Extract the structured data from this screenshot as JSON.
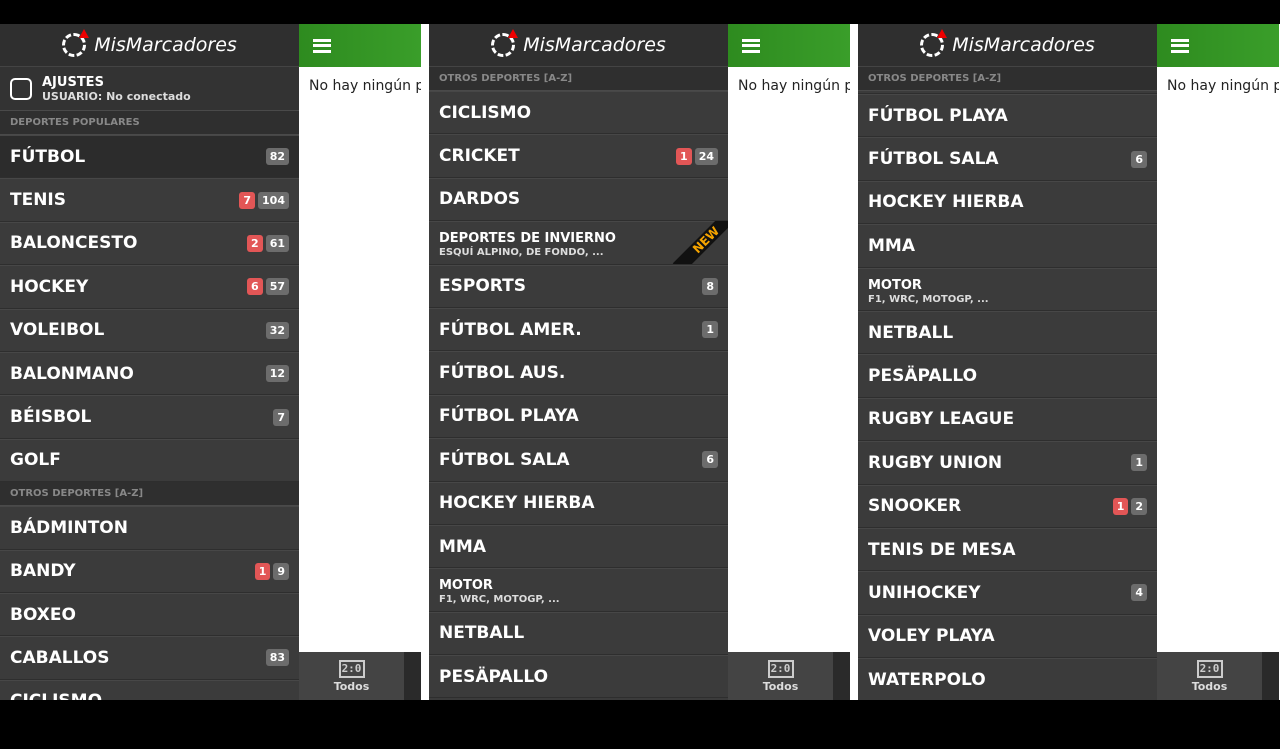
{
  "app": {
    "logo": "MisMarcadores",
    "empty_message": "No hay ningún pa",
    "nav_tab": "Todos",
    "nav_icon_text": "2:0"
  },
  "settings": {
    "title": "AJUSTES",
    "subtitle": "USUARIO: No conectado"
  },
  "colors": {
    "live_badge": "#e25656",
    "count_badge": "#6c6c6c",
    "header_green": "#3a9e2a",
    "new_ribbon": "#f5a400"
  },
  "panels": [
    {
      "settings": true,
      "offset": 0,
      "items": [
        {
          "section": "DEPORTES POPULARES"
        },
        {
          "name": "FÚTBOL",
          "count": "82",
          "active": true
        },
        {
          "name": "TENIS",
          "live": "7",
          "count": "104"
        },
        {
          "name": "BALONCESTO",
          "live": "2",
          "count": "61"
        },
        {
          "name": "HOCKEY",
          "live": "6",
          "count": "57"
        },
        {
          "name": "VOLEIBOL",
          "count": "32"
        },
        {
          "name": "BALONMANO",
          "count": "12"
        },
        {
          "name": "BÉISBOL",
          "count": "7"
        },
        {
          "name": "GOLF"
        },
        {
          "section": "OTROS DEPORTES [A-Z]"
        },
        {
          "name": "BÁDMINTON"
        },
        {
          "name": "BANDY",
          "live": "1",
          "count": "9"
        },
        {
          "name": "BOXEO"
        },
        {
          "name": "CABALLOS",
          "count": "83"
        },
        {
          "name": "CICLISMO"
        }
      ]
    },
    {
      "settings": false,
      "items": [
        {
          "section": "OTROS DEPORTES [A-Z]"
        },
        {
          "name": "CICLISMO"
        },
        {
          "name": "CRICKET",
          "live": "1",
          "count": "24"
        },
        {
          "name": "DARDOS"
        },
        {
          "name": "DEPORTES DE INVIERNO",
          "sub": "ESQUÍ ALPINO, DE FONDO, ...",
          "new": "NEW"
        },
        {
          "name": "ESPORTS",
          "count": "8"
        },
        {
          "name": "FÚTBOL AMER.",
          "count": "1"
        },
        {
          "name": "FÚTBOL AUS."
        },
        {
          "name": "FÚTBOL PLAYA"
        },
        {
          "name": "FÚTBOL SALA",
          "count": "6"
        },
        {
          "name": "HOCKEY HIERBA"
        },
        {
          "name": "MMA"
        },
        {
          "name": "MOTOR",
          "sub": "F1, WRC, MOTOGP, ..."
        },
        {
          "name": "NETBALL"
        },
        {
          "name": "PESÄPALLO"
        }
      ]
    },
    {
      "settings": false,
      "items": [
        {
          "section": "OTROS DEPORTES [A-Z]"
        },
        {
          "name": "FÚTBOL PLAYA"
        },
        {
          "name": "FÚTBOL SALA",
          "count": "6"
        },
        {
          "name": "HOCKEY HIERBA"
        },
        {
          "name": "MMA"
        },
        {
          "name": "MOTOR",
          "sub": "F1, WRC, MOTOGP, ..."
        },
        {
          "name": "NETBALL"
        },
        {
          "name": "PESÄPALLO"
        },
        {
          "name": "RUGBY LEAGUE"
        },
        {
          "name": "RUGBY UNION",
          "count": "1"
        },
        {
          "name": "SNOOKER",
          "live": "1",
          "count": "2"
        },
        {
          "name": "TENIS DE MESA"
        },
        {
          "name": "UNIHOCKEY",
          "count": "4"
        },
        {
          "name": "VOLEY PLAYA"
        },
        {
          "name": "WATERPOLO"
        }
      ]
    }
  ]
}
